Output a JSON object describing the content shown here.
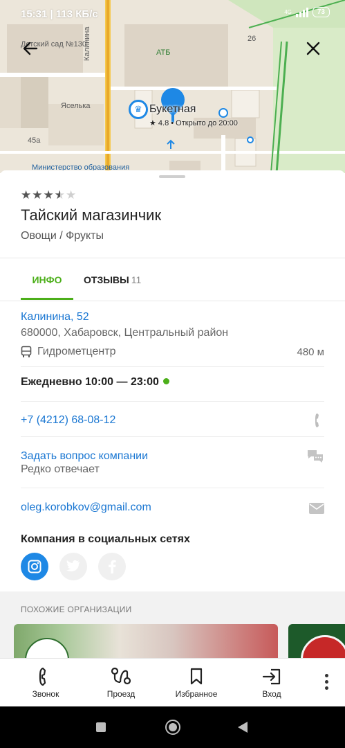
{
  "status_bar": {
    "time_speed": "15:31 | 113 КБ/с",
    "network": "4G",
    "battery": "73"
  },
  "map": {
    "labels": {
      "kindergarten": "Детский сад №130",
      "street": "Калинина",
      "atb": "АТБ",
      "house26": "26",
      "yaselka": "Яселька",
      "house45a": "45а",
      "ministry": "Министерство образования",
      "poi_name": "Букетная",
      "poi_info": "★ 4.8 • Открыто до 20:00"
    },
    "icons": {
      "back": "arrow-left-icon",
      "close": "close-icon"
    }
  },
  "place": {
    "rating_stars": "3.5 of 5",
    "name": "Тайский магазинчик",
    "category": "Овощи / Фрукты"
  },
  "tabs": {
    "info": "ИНФО",
    "reviews": "ОТЗЫВЫ",
    "reviews_count": "11"
  },
  "address": {
    "street": "Калинина, 52",
    "full": "680000, Хабаровск, Центральный район",
    "stop": "Гидрометцентр",
    "distance": "480 м"
  },
  "hours": {
    "text": "Ежедневно 10:00 — 23:00"
  },
  "contacts": {
    "phone": "+7 (4212) 68-08-12",
    "ask": "Задать вопрос компании",
    "ask_sub": "Редко отвечает",
    "email": "oleg.korobkov@gmail.com"
  },
  "social": {
    "title": "Компания в социальных сетях",
    "icons": [
      "instagram-icon",
      "twitter-icon",
      "facebook-icon"
    ]
  },
  "similar": {
    "title": "ПОХОЖИЕ ОРГАНИЗАЦИИ"
  },
  "toolbar": {
    "call": "Звонок",
    "route": "Проезд",
    "favorites": "Избранное",
    "enter": "Вход"
  },
  "colors": {
    "accent_green": "#4caf1a",
    "link_blue": "#1976d2",
    "pin_blue": "#1e88e5"
  }
}
